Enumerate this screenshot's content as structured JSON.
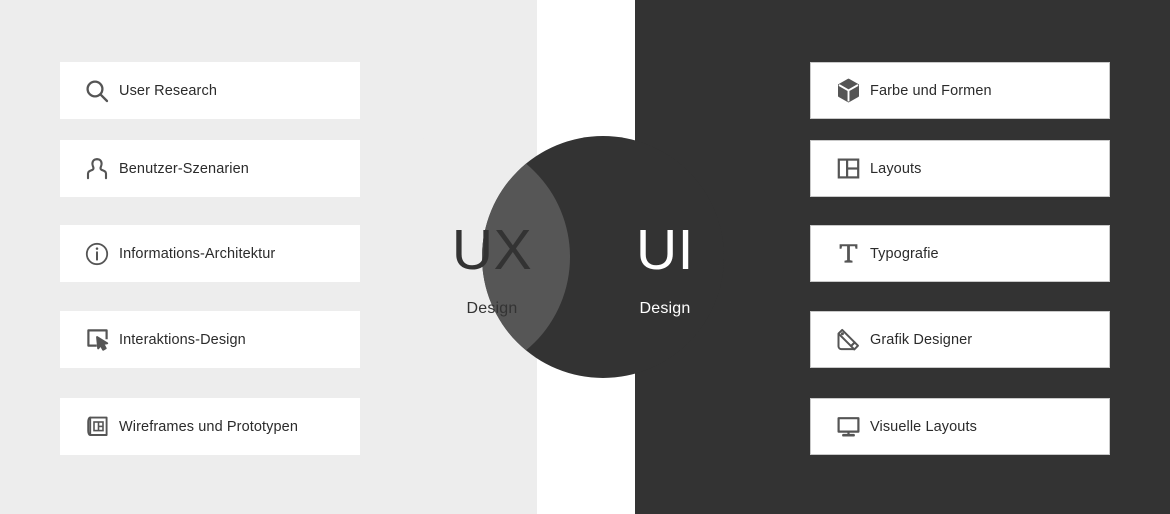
{
  "colors": {
    "panel_left_bg": "#ededed",
    "panel_right_bg": "#333333",
    "overlap": "#565656",
    "card_bg": "#ffffff",
    "icon": "#555555",
    "text_dark": "#2b2b2b",
    "text_light": "#ffffff"
  },
  "center": {
    "ux": {
      "title": "UX",
      "subtitle": "Design"
    },
    "ui": {
      "title": "UI",
      "subtitle": "Design"
    }
  },
  "left_column": {
    "items": [
      {
        "label": "User Research",
        "icon": "search-icon"
      },
      {
        "label": "Benutzer-Szenarien",
        "icon": "user-persona-icon"
      },
      {
        "label": "Informations-Architektur",
        "icon": "info-circle-icon"
      },
      {
        "label": "Interaktions-Design",
        "icon": "click-pointer-icon"
      },
      {
        "label": "Wireframes und Prototypen",
        "icon": "blueprint-icon"
      }
    ]
  },
  "right_column": {
    "items": [
      {
        "label": "Farbe und Formen",
        "icon": "cube-icon"
      },
      {
        "label": "Layouts",
        "icon": "layout-grid-icon"
      },
      {
        "label": "Typografie",
        "icon": "typography-t-icon"
      },
      {
        "label": "Grafik Designer",
        "icon": "color-swatch-icon"
      },
      {
        "label": "Visuelle Layouts",
        "icon": "monitor-icon"
      }
    ]
  }
}
